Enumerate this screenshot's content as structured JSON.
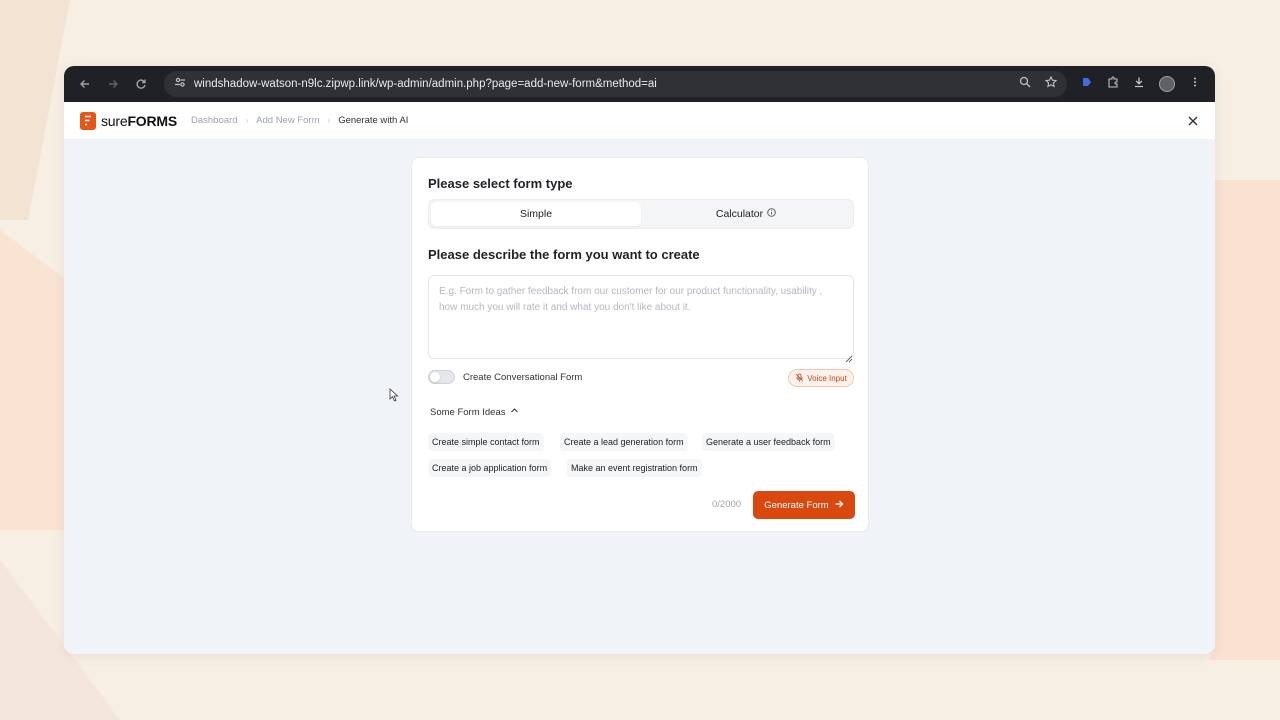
{
  "browser": {
    "url": "windshadow-watson-n9lc.zipwp.link/wp-admin/admin.php?page=add-new-form&method=ai",
    "icons": [
      "back-icon",
      "forward-icon",
      "reload-icon",
      "site-info-icon",
      "zoom-icon",
      "star-icon",
      "extension-icon",
      "puzzle-icon",
      "download-icon",
      "profile-avatar",
      "menu-icon"
    ]
  },
  "app": {
    "logo_light": "sure",
    "logo_bold": "FORMS",
    "breadcrumbs": [
      "Dashboard",
      "Add New Form",
      "Generate with AI"
    ],
    "accent": "#d9480f"
  },
  "form": {
    "type_heading": "Please select form type",
    "types": [
      "Simple",
      "Calculator"
    ],
    "selected_type": "Simple",
    "describe_heading": "Please describe the form you want to create",
    "placeholder": "E.g. Form to gather feedback from our customer for our product functionality, usability , how much you will rate it and what you don't like about it.",
    "value": "",
    "conversational_label": "Create Conversational Form",
    "conversational_on": false,
    "voice_label": "Voice Input",
    "ideas_heading": "Some Form Ideas",
    "ideas": [
      "Create simple contact form",
      "Create a lead generation form",
      "Generate a user feedback form",
      "Create a job application form",
      "Make an event registration form"
    ],
    "counter": "0/2000",
    "generate_label": "Generate Form"
  }
}
